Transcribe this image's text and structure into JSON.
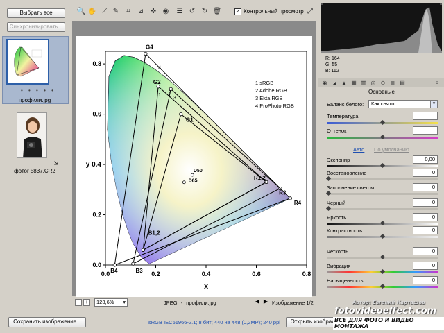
{
  "filmstrip": {
    "select_all": "Выбрать все",
    "sync": "Синхронизировать...",
    "thumb1_label": "профили.jpg",
    "thumb2_label": "фотоr 5837.CR2"
  },
  "toolbar": {
    "preview_label": "Контрольный просмотр",
    "preview_checked": "✓"
  },
  "chart_data": {
    "type": "scatter",
    "ylabel": "y",
    "xlabel": "x",
    "x_ticks": [
      "0.0",
      "0.2",
      "0.4",
      "0.6",
      "0.8"
    ],
    "y_ticks": [
      "0.0",
      "0.2",
      "0.4",
      "0.6",
      "0.8"
    ],
    "y_mid_label": "y 0.4",
    "legend": [
      "1 sRGB",
      "2 Adobe RGB",
      "3 Ekta RGB",
      "4 ProPhoto RGB"
    ],
    "labels": {
      "g4": "G4",
      "g2": "G2",
      "g1": "G1",
      "d50": "D50",
      "d65": "D65",
      "r12": "R1,2",
      "r3": "R3",
      "r4": "R4",
      "b12": "B1,2",
      "b4": "B4",
      "b3": "B3"
    },
    "gamuts": [
      {
        "name": "sRGB",
        "points": [
          [
            0.64,
            0.33
          ],
          [
            0.3,
            0.6
          ],
          [
            0.15,
            0.06
          ]
        ]
      },
      {
        "name": "Adobe RGB",
        "points": [
          [
            0.64,
            0.33
          ],
          [
            0.21,
            0.71
          ],
          [
            0.15,
            0.06
          ]
        ]
      },
      {
        "name": "Ekta RGB",
        "points": [
          [
            0.695,
            0.305
          ],
          [
            0.26,
            0.7
          ],
          [
            0.11,
            0.005
          ]
        ]
      },
      {
        "name": "ProPhoto RGB",
        "points": [
          [
            0.7347,
            0.2653
          ],
          [
            0.1596,
            0.8404
          ],
          [
            0.0366,
            0.0001
          ]
        ]
      }
    ],
    "whitepoints": [
      {
        "name": "D50",
        "x": 0.3457,
        "y": 0.3585
      },
      {
        "name": "D65",
        "x": 0.3127,
        "y": 0.329
      }
    ],
    "xlim": [
      0.0,
      0.8
    ],
    "ylim": [
      0.0,
      0.85
    ]
  },
  "canvas_status": {
    "zoom": "123,6%",
    "format": "JPEG",
    "sep": "-",
    "filename": "профили.jpg",
    "counter": "Изображение 1/2"
  },
  "right_panel": {
    "rgb_r": "R:   164",
    "rgb_g": "G:    55",
    "rgb_b": "B:   112",
    "section": "Основные",
    "wb_label": "Баланс белого:",
    "wb_value": "Как снято",
    "temp": "Температура",
    "tint": "Оттенок",
    "auto": "Авто",
    "default": "По умолчанию",
    "exposure": "Экспонир",
    "exposure_value": "0,00",
    "recovery": "Восстановление",
    "recovery_value": "0",
    "fill": "Заполнение светом",
    "fill_value": "0",
    "blacks": "Черный",
    "blacks_value": "0",
    "brightness": "Яркость",
    "brightness_value": "0",
    "contrast": "Контрастность",
    "contrast_value": "0",
    "clarity": "Четкость",
    "clarity_value": "0",
    "vibrance": "Вибрация",
    "vibrance_value": "0",
    "saturation": "Насыщенность",
    "saturation_value": "0"
  },
  "bottom": {
    "save": "Сохранить изображение...",
    "info": "sRGB IEC61966-2.1; 8 бит; 440 на 448 (0,2МР); 240 ppi",
    "open": "Открыть изображение",
    "author": "Автор: Евгений Карташов",
    "site": "fotovideoeffect.com",
    "tagline": "ВСЕ ДЛЯ ФОТО И ВИДЕО МОНТАЖА"
  }
}
